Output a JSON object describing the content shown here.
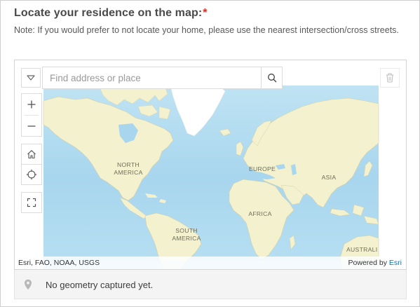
{
  "question": {
    "title": "Locate your residence on the map:",
    "required_marker": "*",
    "note": "Note: If you would prefer to not locate your home, please use the nearest intersection/cross streets."
  },
  "map": {
    "search": {
      "placeholder": "Find address or place",
      "value": ""
    },
    "labels": {
      "north_america": [
        "NORTH",
        "AMERICA"
      ],
      "europe": "EUROPE",
      "asia": "ASIA",
      "africa": "AFRICA",
      "south_america": [
        "SOUTH",
        "AMERICA"
      ],
      "australia": "AUSTRALI"
    },
    "attribution": {
      "sources": "Esri, FAO, NOAA, USGS",
      "powered_by": "Powered by",
      "powered_by_link": "Esri"
    },
    "colors": {
      "ocean": "#bfe3f3",
      "land": "#f4f1cf",
      "ice": "#ffffff",
      "accent": "#0079c1",
      "required": "#d83020"
    },
    "icons": {
      "expand": "chevron-down-icon",
      "search": "search-icon",
      "delete": "trash-icon",
      "zoom_in": "plus-icon",
      "zoom_out": "minus-icon",
      "home": "home-icon",
      "locate": "crosshair-icon",
      "fullscreen": "fullscreen-icon",
      "pin": "map-pin-icon"
    }
  },
  "status": {
    "geometry": "No geometry captured yet."
  }
}
